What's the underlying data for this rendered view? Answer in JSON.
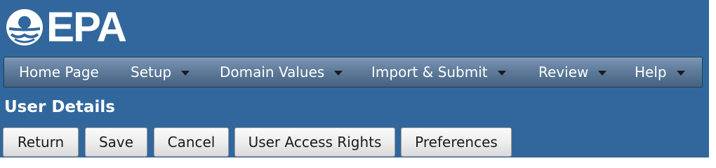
{
  "logo": {
    "text": "EPA",
    "icon": "epa-flower-logo-icon"
  },
  "nav": {
    "items": [
      {
        "label": "Home Page",
        "has_dropdown": false
      },
      {
        "label": "Setup",
        "has_dropdown": true
      },
      {
        "label": "Domain Values",
        "has_dropdown": true
      },
      {
        "label": "Import & Submit",
        "has_dropdown": true
      },
      {
        "label": "Review",
        "has_dropdown": true
      },
      {
        "label": "Help",
        "has_dropdown": true
      }
    ]
  },
  "page": {
    "title": "User Details"
  },
  "buttons": {
    "return_label": "Return",
    "save_label": "Save",
    "cancel_label": "Cancel",
    "user_access_rights_label": "User Access Rights",
    "preferences_label": "Preferences"
  },
  "colors": {
    "page_background": "#31679c",
    "nav_bar": "#5f7c9c",
    "text_on_dark": "#ffffff",
    "button_background": "#ececec"
  }
}
